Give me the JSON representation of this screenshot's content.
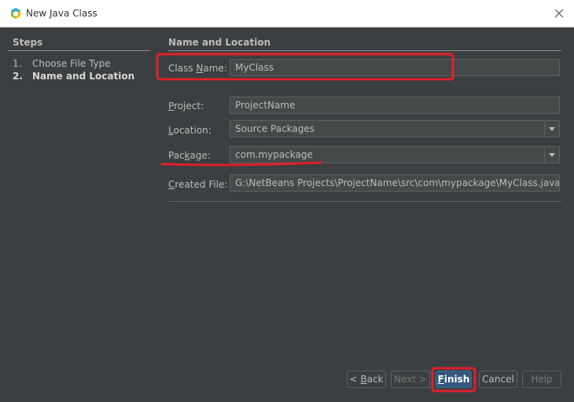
{
  "window": {
    "title": "New Java Class"
  },
  "steps": {
    "header": "Steps",
    "items": [
      {
        "num": "1.",
        "label": "Choose File Type"
      },
      {
        "num": "2.",
        "label": "Name and Location"
      }
    ]
  },
  "main": {
    "header": "Name and Location",
    "class_name": {
      "label_pre": "Class ",
      "label_mn": "N",
      "label_post": "ame:",
      "value": "MyClass"
    },
    "project": {
      "label_pre": "",
      "label_mn": "P",
      "label_post": "roject:",
      "value": "ProjectName"
    },
    "location": {
      "label_pre": "",
      "label_mn": "L",
      "label_post": "ocation:",
      "value": "Source Packages"
    },
    "package": {
      "label_pre": "Pac",
      "label_mn": "k",
      "label_post": "age:",
      "value": "com.mypackage"
    },
    "created_file": {
      "label_pre": "",
      "label_mn": "C",
      "label_post": "reated File:",
      "value": "G:\\NetBeans Projects\\ProjectName\\src\\com\\mypackage\\MyClass.java"
    }
  },
  "buttons": {
    "back": {
      "pre": "< ",
      "mn": "B",
      "post": "ack"
    },
    "next": "Next >",
    "finish": {
      "pre": "",
      "mn": "F",
      "post": "inish"
    },
    "cancel": "Cancel",
    "help": "Help"
  },
  "colors": {
    "background": "#3c3f41",
    "field_bg": "#45494a",
    "primary_button": "#365880",
    "annotation": "#e0202a"
  }
}
